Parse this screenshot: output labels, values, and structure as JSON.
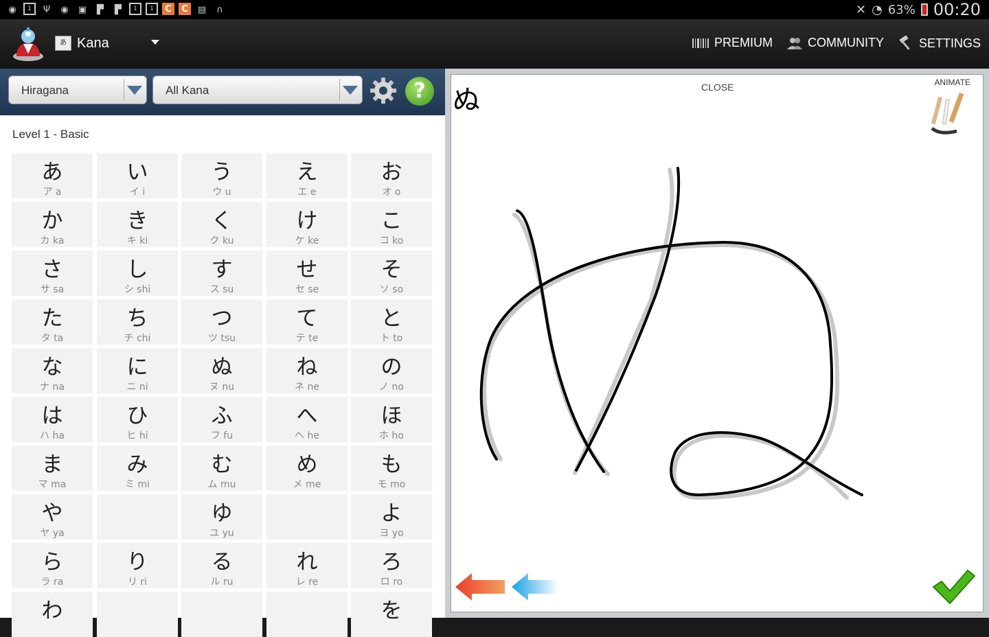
{
  "status_bar": {
    "battery": "63%",
    "time": "00:20",
    "icons": [
      "sync-icon",
      "one-icon",
      "usb-icon",
      "sync-icon",
      "gallery-icon",
      "f-icon",
      "f-icon",
      "one-icon",
      "one-icon",
      "c-icon",
      "c-icon",
      "briefcase-icon",
      "headset-icon"
    ]
  },
  "action_bar": {
    "title": "Kana",
    "premium": "PREMIUM",
    "community": "COMMUNITY",
    "settings": "SETTINGS"
  },
  "filters": {
    "script": "Hiragana",
    "set": "All Kana",
    "help_glyph": "?"
  },
  "level_label": "Level 1 - Basic",
  "kana_rows": [
    [
      {
        "k": "あ",
        "s": "ア a"
      },
      {
        "k": "い",
        "s": "イ i"
      },
      {
        "k": "う",
        "s": "ウ u"
      },
      {
        "k": "え",
        "s": "エ e"
      },
      {
        "k": "お",
        "s": "オ o"
      }
    ],
    [
      {
        "k": "か",
        "s": "カ ka"
      },
      {
        "k": "き",
        "s": "キ ki"
      },
      {
        "k": "く",
        "s": "ク ku"
      },
      {
        "k": "け",
        "s": "ケ ke"
      },
      {
        "k": "こ",
        "s": "コ ko"
      }
    ],
    [
      {
        "k": "さ",
        "s": "サ sa"
      },
      {
        "k": "し",
        "s": "シ shi"
      },
      {
        "k": "す",
        "s": "ス su"
      },
      {
        "k": "せ",
        "s": "セ se"
      },
      {
        "k": "そ",
        "s": "ソ so"
      }
    ],
    [
      {
        "k": "た",
        "s": "タ ta"
      },
      {
        "k": "ち",
        "s": "チ chi"
      },
      {
        "k": "つ",
        "s": "ツ tsu"
      },
      {
        "k": "て",
        "s": "テ te"
      },
      {
        "k": "と",
        "s": "ト to"
      }
    ],
    [
      {
        "k": "な",
        "s": "ナ na"
      },
      {
        "k": "に",
        "s": "ニ ni"
      },
      {
        "k": "ぬ",
        "s": "ヌ nu"
      },
      {
        "k": "ね",
        "s": "ネ ne"
      },
      {
        "k": "の",
        "s": "ノ no"
      }
    ],
    [
      {
        "k": "は",
        "s": "ハ ha"
      },
      {
        "k": "ひ",
        "s": "ヒ hi"
      },
      {
        "k": "ふ",
        "s": "フ fu"
      },
      {
        "k": "へ",
        "s": "ヘ he"
      },
      {
        "k": "ほ",
        "s": "ホ ho"
      }
    ],
    [
      {
        "k": "ま",
        "s": "マ ma"
      },
      {
        "k": "み",
        "s": "ミ mi"
      },
      {
        "k": "む",
        "s": "ム mu"
      },
      {
        "k": "め",
        "s": "メ me"
      },
      {
        "k": "も",
        "s": "モ mo"
      }
    ],
    [
      {
        "k": "や",
        "s": "ヤ ya"
      },
      null,
      {
        "k": "ゆ",
        "s": "ユ yu"
      },
      null,
      {
        "k": "よ",
        "s": "ヨ yo"
      }
    ],
    [
      {
        "k": "ら",
        "s": "ラ ra"
      },
      {
        "k": "り",
        "s": "リ ri"
      },
      {
        "k": "る",
        "s": "ル ru"
      },
      {
        "k": "れ",
        "s": "レ re"
      },
      {
        "k": "ろ",
        "s": "ロ ro"
      }
    ],
    [
      {
        "k": "わ",
        "s": ""
      },
      null,
      null,
      null,
      {
        "k": "を",
        "s": ""
      }
    ]
  ],
  "practice": {
    "target_kana": "ぬ",
    "close": "CLOSE",
    "animate": "ANIMATE"
  },
  "colors": {
    "filter_bar": "#2a4461",
    "accent_blue": "#4d6f95",
    "help_green": "#3f9a17",
    "check_green": "#4bb81a",
    "arrow_red": "#e8402a",
    "arrow_blue": "#1aa0e8"
  }
}
